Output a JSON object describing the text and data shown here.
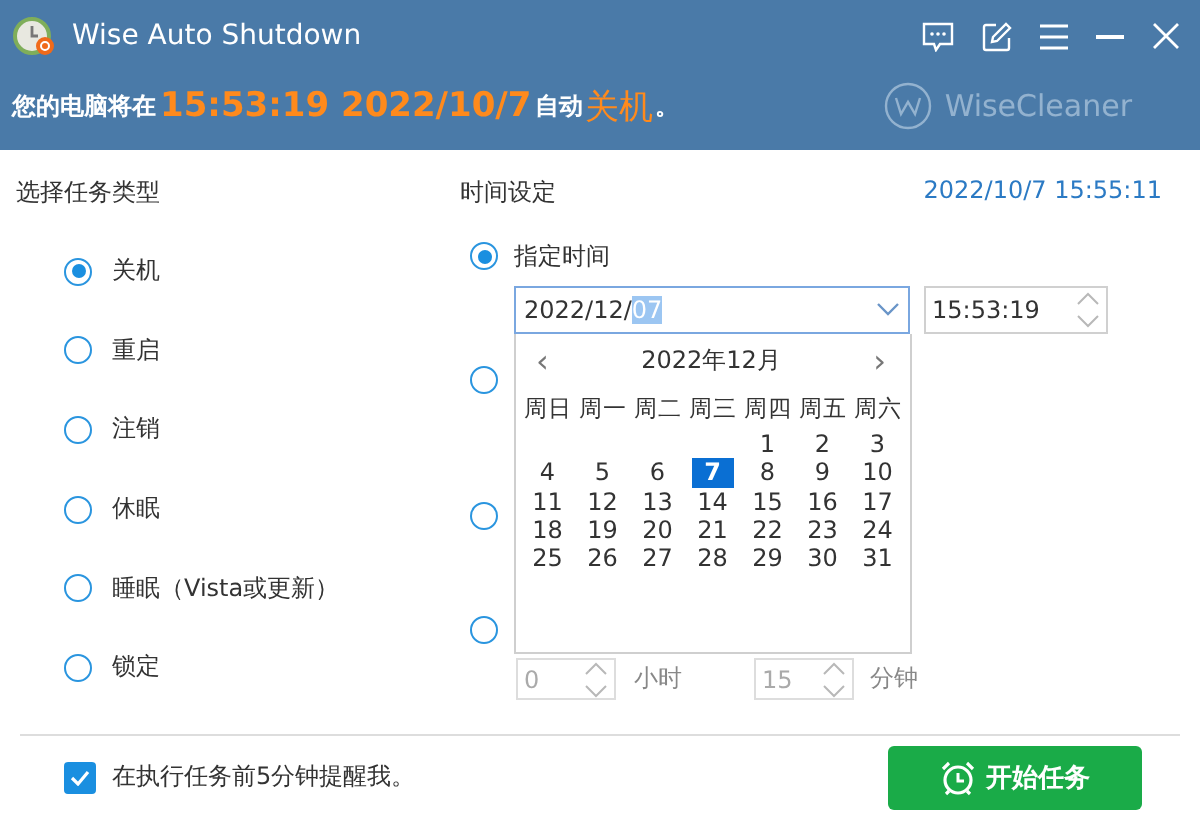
{
  "window": {
    "title": "Wise Auto Shutdown"
  },
  "banner": {
    "prefix": "您的电脑将在",
    "time": "15:53:19 2022/10/7",
    "middle": "自动",
    "action": "关机",
    "suffix": "。",
    "brand": "WiseCleaner"
  },
  "task_type": {
    "heading": "选择任务类型",
    "options": [
      {
        "label": "关机",
        "selected": true
      },
      {
        "label": "重启",
        "selected": false
      },
      {
        "label": "注销",
        "selected": false
      },
      {
        "label": "休眠",
        "selected": false
      },
      {
        "label": "睡眠（Vista或更新）",
        "selected": false
      },
      {
        "label": "锁定",
        "selected": false
      }
    ]
  },
  "time_settings": {
    "heading": "时间设定",
    "current_time": "2022/10/7 15:55:11",
    "options": [
      {
        "kind": "scheduled",
        "label": "指定时间",
        "selected": true,
        "date_text": "2022/12/",
        "date_selected_text": "07",
        "time_value": "15:53:19"
      },
      {
        "kind": "covered",
        "selected": false
      },
      {
        "kind": "covered",
        "selected": false
      },
      {
        "kind": "countdown",
        "selected": false,
        "hours": "0",
        "hours_unit": "小时",
        "minutes": "15",
        "minutes_unit": "分钟"
      }
    ],
    "calendar": {
      "prev": "‹",
      "title": "2022年12月",
      "next": "›",
      "weekdays": [
        "周日",
        "周一",
        "周二",
        "周三",
        "周四",
        "周五",
        "周六"
      ],
      "weeks": [
        [
          {
            "day": "1",
            "selected": false
          },
          {
            "day": "2",
            "selected": false
          },
          {
            "day": "3",
            "selected": false
          }
        ],
        [
          {
            "day": "4",
            "selected": false
          },
          {
            "day": "5",
            "selected": false
          },
          {
            "day": "6",
            "selected": false
          },
          {
            "day": "7",
            "selected": true
          },
          {
            "day": "8",
            "selected": false
          },
          {
            "day": "9",
            "selected": false
          },
          {
            "day": "10",
            "selected": false
          }
        ],
        [
          {
            "day": "11",
            "selected": false
          },
          {
            "day": "12",
            "selected": false
          },
          {
            "day": "13",
            "selected": false
          },
          {
            "day": "14",
            "selected": false
          },
          {
            "day": "15",
            "selected": false
          },
          {
            "day": "16",
            "selected": false
          },
          {
            "day": "17",
            "selected": false
          }
        ],
        [
          {
            "day": "18",
            "selected": false
          },
          {
            "day": "19",
            "selected": false
          },
          {
            "day": "20",
            "selected": false
          },
          {
            "day": "21",
            "selected": false
          },
          {
            "day": "22",
            "selected": false
          },
          {
            "day": "23",
            "selected": false
          },
          {
            "day": "24",
            "selected": false
          }
        ],
        [
          {
            "day": "25",
            "selected": false
          },
          {
            "day": "26",
            "selected": false
          },
          {
            "day": "27",
            "selected": false
          },
          {
            "day": "28",
            "selected": false
          },
          {
            "day": "29",
            "selected": false
          },
          {
            "day": "30",
            "selected": false
          },
          {
            "day": "31",
            "selected": false
          }
        ]
      ]
    }
  },
  "reminder": {
    "label": "在执行任务前5分钟提醒我。",
    "checked": true
  },
  "start_button": {
    "label": "开始任务"
  }
}
